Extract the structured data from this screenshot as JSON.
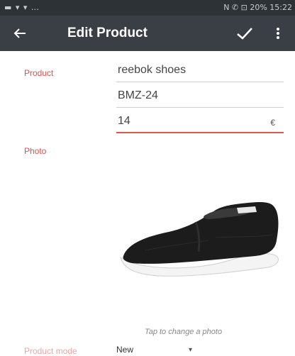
{
  "status_bar": {
    "left_icons": "▬ ▾ ▾ …",
    "right_text": "N ✆ ⊡ 20% 15:22"
  },
  "app_bar": {
    "back_icon": "arrow-left-icon",
    "title": "Edit Product",
    "save_icon": "check-icon",
    "menu_icon": "more-vert-icon",
    "background": "#3a3f45"
  },
  "form": {
    "product_label": "Product",
    "product_name": "reebok shoes",
    "product_code": "BMZ-24",
    "price": "14",
    "price_suffix": "€",
    "photo_label": "Photo",
    "photo_hint": "Tap to change a photo",
    "mode_label": "Product mode",
    "mode_value": "New"
  },
  "colors": {
    "accent": "#e2574c",
    "label_red": "#e64a4a"
  }
}
